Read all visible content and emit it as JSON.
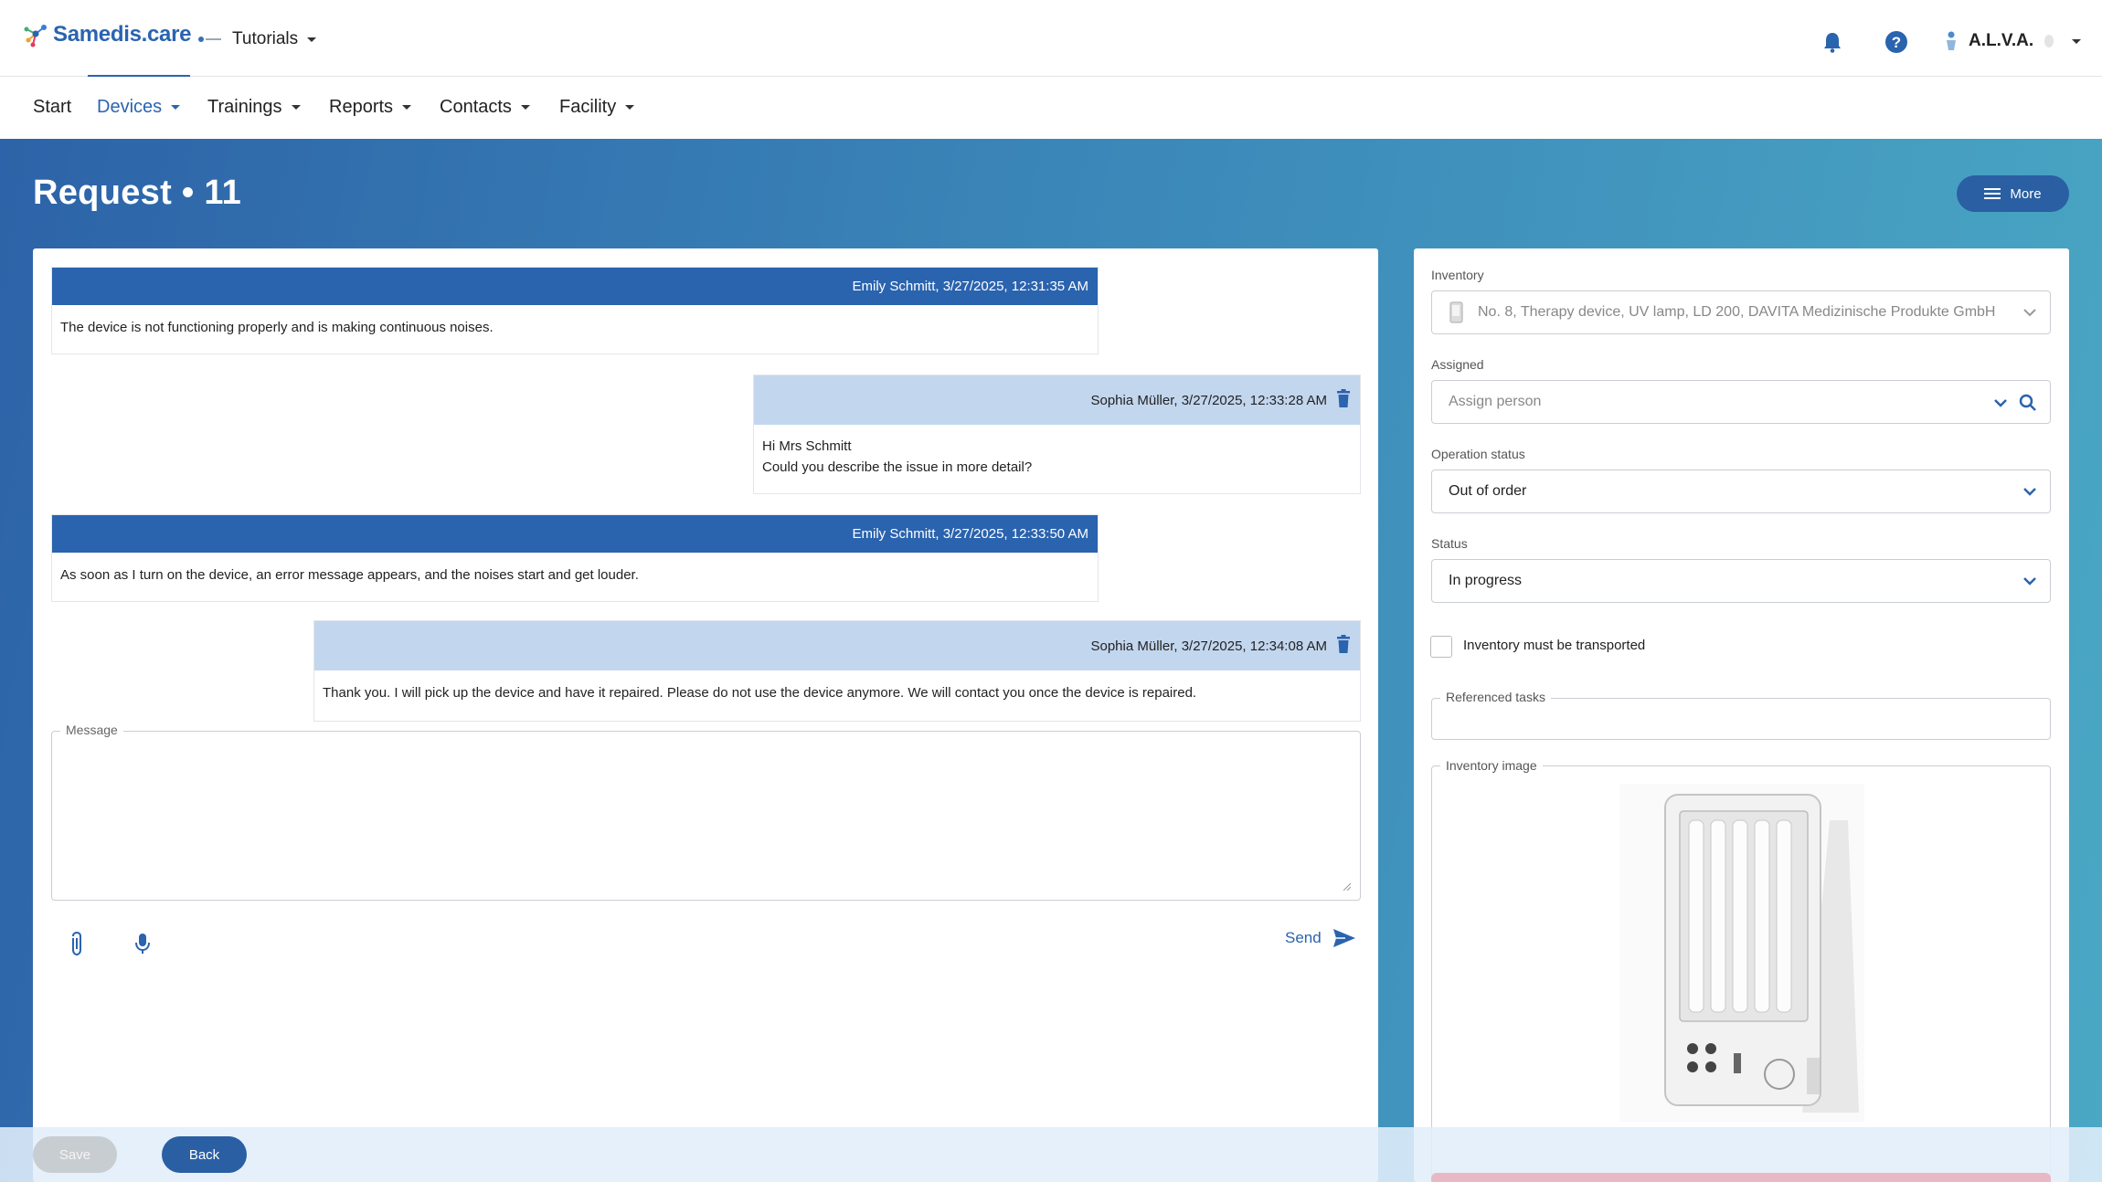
{
  "app": {
    "logo": "Samedis.care",
    "tenant": "Tutorials",
    "user": "A.L.V.A."
  },
  "icons": {
    "logo": "network-logo-icon",
    "tenant": "tenant-logo-icon",
    "bell": "bell-icon",
    "help": "help-icon",
    "user": "user-icon"
  },
  "nav": {
    "start": "Start",
    "devices": "Devices",
    "trainings": "Trainings",
    "reports": "Reports",
    "contacts": "Contacts",
    "facility": "Facility"
  },
  "page": {
    "title": "Request • 11",
    "more": "More"
  },
  "messages": [
    {
      "author": "Emily Schmitt, 3/27/2025, 12:31:35 AM",
      "text": "The device is not functioning properly and is making continuous noises."
    },
    {
      "author": "Sophia Müller, 3/27/2025, 12:33:28 AM",
      "line1": "Hi Mrs Schmitt",
      "line2": "Could you describe the issue in more detail?"
    },
    {
      "author": "Emily Schmitt, 3/27/2025, 12:33:50 AM",
      "text": "As soon as I turn on the device, an error message appears, and the noises start and get louder."
    },
    {
      "author": "Sophia Müller, 3/27/2025, 12:34:08 AM",
      "text": "Thank you. I will pick up the device and have it repaired. Please do not use the device anymore. We will contact you once the device is repaired."
    }
  ],
  "composer": {
    "label": "Message",
    "send": "Send"
  },
  "form": {
    "inventory_label": "Inventory",
    "inventory_value": "No. 8, Therapy device, UV lamp, LD 200, DAVITA Medizinische Produkte GmbH &",
    "assigned_label": "Assigned",
    "assigned_placeholder": "Assign person",
    "op_status_label": "Operation status",
    "op_status_value": "Out of order",
    "status_label": "Status",
    "status_value": "In progress",
    "transport_label": "Inventory must be transported",
    "transport_checked": false,
    "ref_tasks_label": "Referenced tasks",
    "image_label": "Inventory image"
  },
  "footer": {
    "save": "Save",
    "back": "Back"
  },
  "colors": {
    "primary": "#2a63ae",
    "header_light": "#c2d6ee",
    "gradient_start": "#2d63a8",
    "gradient_end": "#4aa8c4"
  }
}
